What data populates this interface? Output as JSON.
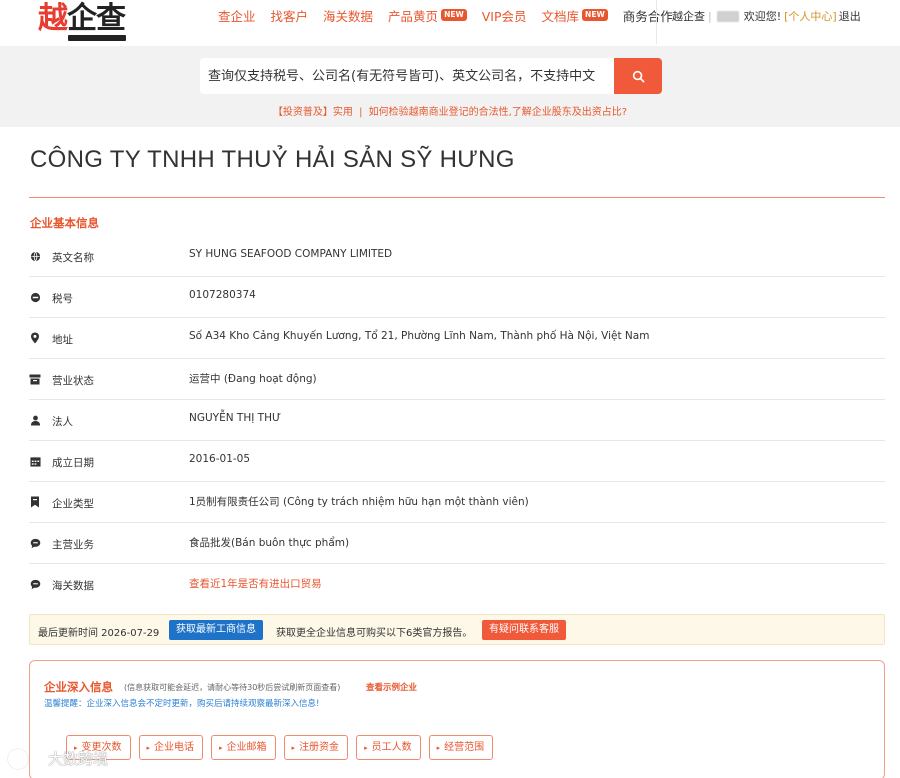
{
  "header": {
    "logo_char": "越",
    "logo_rest": "企查",
    "nav": [
      {
        "label": "查企业",
        "is_new": false
      },
      {
        "label": "找客户",
        "is_new": false
      },
      {
        "label": "海关数据",
        "is_new": false
      },
      {
        "label": "产品黄页",
        "is_new": true
      },
      {
        "label": "VIP会员",
        "is_new": false
      },
      {
        "label": "文档库",
        "is_new": true
      },
      {
        "label": "商务合作",
        "is_new": false
      }
    ],
    "new_badge": "NEW",
    "user": {
      "site": "越企查",
      "welcome": "欢迎您!",
      "personal_center": "[个人中心]",
      "logout": "退出"
    }
  },
  "search": {
    "placeholder": "查询仅支持税号、公司名(有无符号皆可)、英文公司名，不支持中文",
    "tip_tag": "【投资普及】实用",
    "tip_sep": "|",
    "tip_text": "如何检验越南商业登记的合法性,了解企业股东及出资占比?",
    "button_icon": "search-icon"
  },
  "company": {
    "name": "CÔNG TY TNHH THUỶ HẢI SẢN SỸ HƯNG"
  },
  "basic_info": {
    "section_title": "企业基本信息",
    "rows": [
      {
        "icon": "globe-icon",
        "label": "英文名称",
        "value": "SY HUNG SEAFOOD COMPANY LIMITED"
      },
      {
        "icon": "tax-icon",
        "label": "税号",
        "value": "0107280374"
      },
      {
        "icon": "location-pin-icon",
        "label": "地址",
        "value": "Số A34 Kho Cảng Khuyến Lương, Tổ 21, Phường Lĩnh Nam, Thành phố Hà Nội, Việt Nam"
      },
      {
        "icon": "store-icon",
        "label": "营业状态",
        "value": "运营中 (Đang hoạt động)"
      },
      {
        "icon": "person-icon",
        "label": "法人",
        "value": "NGUYỄN THỊ THƯ"
      },
      {
        "icon": "calendar-icon",
        "label": "成立日期",
        "value": "2016-01-05"
      },
      {
        "icon": "bookmark-icon",
        "label": "企业类型",
        "value": "1员制有限责任公司 (Công ty trách nhiệm hữu hạn một thành viên)"
      },
      {
        "icon": "chat-icon",
        "label": "主营业务",
        "value": "食品批发(Bán buôn thực phẩm)"
      },
      {
        "icon": "chat-icon",
        "label": "海关数据",
        "value": "查看近1年是否有进出口贸易"
      }
    ]
  },
  "update_bar": {
    "last_update": "最后更新时间 2026-07-29",
    "refresh_button": "获取最新工商信息",
    "more_text": "获取更全企业信息可购买以下6类官方报告。",
    "contact_button": "有疑问联系客服"
  },
  "deep_info": {
    "title": "企业深入信息",
    "note": "(信息获取可能会延迟，请耐心等待30秒后尝试刷新页面查看)",
    "example_link": "查看示例企业",
    "warning": "温馨提醒：企业深入信息会不定时更新，购买后请持续观察最新深入信息!",
    "buttons": [
      "变更次数",
      "企业电话",
      "企业邮箱",
      "注册资金",
      "员工人数",
      "经营范围"
    ]
  },
  "watermark": {
    "text": "大数跨境"
  },
  "colors": {
    "accent": "#e8572f",
    "button_orange": "#f0593a",
    "button_blue": "#1e73c8",
    "update_bg": "#fdf8e7"
  }
}
